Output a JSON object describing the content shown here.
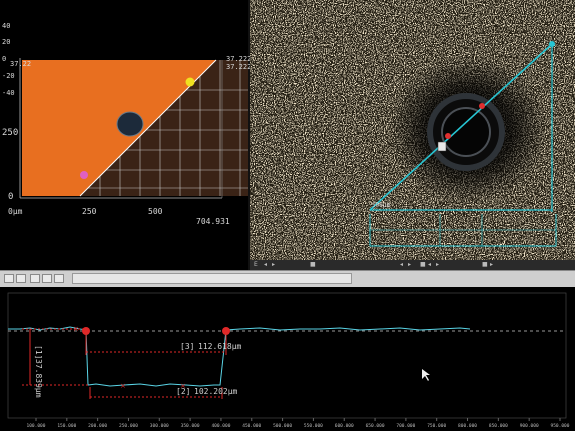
{
  "view3d": {
    "y_ticks": [
      "40",
      "20",
      "0",
      "-20",
      "-40"
    ],
    "z_label_top": "37.22",
    "z_label_mid": "37.222",
    "z_label_bottom": "37.222",
    "y_axis_label_250": "250",
    "y_axis_label_0": "0",
    "x_origin_label": "0μm",
    "x_tick_250": "250",
    "x_tick_500": "500",
    "x_extent": "704.931",
    "colors": {
      "surface_orange": "#e0661c",
      "surface_dark": "#3a2316",
      "grid": "#c8c8c8"
    }
  },
  "microscope": {
    "scale_label": "500μm",
    "status_items": [
      "E",
      "◂",
      "▸",
      "",
      "■",
      "◂",
      "▸",
      "■",
      "◂",
      "▸",
      "■",
      "▸"
    ],
    "colors": {
      "measure_line": "#27c6d4",
      "marker": "#e03030"
    }
  },
  "profile": {
    "measurements": [
      {
        "id": "[1]",
        "value": "37.839μm"
      },
      {
        "id": "[3]",
        "value": "112.618μm"
      },
      {
        "id": "[2]",
        "value": "102.202μm"
      }
    ],
    "x_ticks": [
      "100.000",
      "150.000",
      "200.000",
      "250.000",
      "300.000",
      "350.000",
      "400.000",
      "450.000",
      "500.000",
      "550.000",
      "600.000",
      "650.000",
      "700.000",
      "750.000",
      "800.000",
      "850.000",
      "900.000",
      "950.000"
    ],
    "colors": {
      "trace": "#5ad4e6",
      "measure": "#e02828",
      "dashed": "#cccccc"
    }
  }
}
